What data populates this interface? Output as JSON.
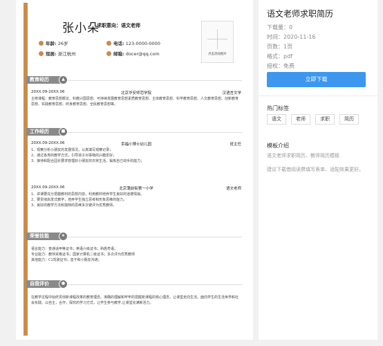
{
  "resume": {
    "name": "张小朵",
    "job_label": "求职意向：",
    "job_value": "语文老师",
    "info": {
      "age_label": "年龄:",
      "age_value": "26岁",
      "phone_label": "电话:",
      "phone_value": "123-0000-0000",
      "location_label": "现居:",
      "location_value": "浙江杭州",
      "email_label": "邮箱:",
      "email_value": "docer@qq.com"
    },
    "photo_caption": "点击添加图片",
    "accent_color": "#c98d4b",
    "sections": {
      "education": {
        "title": "教育经历",
        "icon": "graduation-cap-icon",
        "rows": [
          {
            "date": "20XX.09-20XX.06",
            "org": "北京华安师范学院",
            "role": "汉语言文学"
          }
        ],
        "desc": "主修课程：教育思想概论、科教兴国思想、可持续发展教育思想素质教育思想、主体教育思想、科学教育思想、人文教育思想、创新教育思想、实践教育思想、终身教育思想、全民教育思想等。"
      },
      "work": {
        "title": "工作经历",
        "icon": "briefcase-icon",
        "rows": [
          {
            "date": "20XX.09-20XX.06",
            "org": "幸福小博士幼儿园",
            "role": "班主任",
            "items": [
              "1、观察分析小朋友的发展情况，认真填写观察记录；",
              "2、通过各类的教学方式，引导孩子对事物的兴趣爱好；",
              "3、接待和配合园长要求管理好小朋友的日常生活，锻炼自己动手的能力；"
            ]
          },
          {
            "date": "20XX.09-20XX.06",
            "org": "北京蒲前街第一小学",
            "role": "语文老师",
            "items": [
              "1、讲课要充分把握教材的思想内容，利用教材培养学生良好的道德情操。",
              "2、要贯彻启发式教学，培养学生独立思考和形象思维的能力。",
              "3、良好的教学方法和独特的思维多次被评为优秀教师。"
            ]
          }
        ]
      },
      "skills": {
        "title": "荣誉技能",
        "icon": "trophy-icon",
        "lines": [
          "语言能力：普通话甲等证书；英语六级证书；熟悉粤语；",
          "专业能力：教师资格证书；国家计算机二级证书；多次评为优秀教师",
          "其他能力：C1驾驶证书；善于和小朋友沟通；"
        ]
      },
      "self": {
        "title": "自我评价",
        "icon": "link-icon",
        "desc": "在教学过程中始终贯彻新课程改革的教育理念。准确的理解和牢牢的把握新课程的核心理念，让课堂走向生活，面向学生的生活世界和社会实践。以自主，合作，探究的学习方式，让学生参与教学,让课堂充满新活力。"
      }
    }
  },
  "sidebar": {
    "title": "语文老师求职简历",
    "downloads": "下载量：0",
    "time": "时间：2020-11-16",
    "pages": "页数：1页",
    "format": "格式：pdf",
    "license": "授权：免费",
    "download_button": "立即下载",
    "accent_color": "#3d97ef",
    "tags_heading": "热门标签",
    "tags": [
      "语文",
      "老师",
      "求职",
      "简历"
    ],
    "intro_heading": "模板介绍",
    "intro_text": "语文老师求职简历、教师简历模板",
    "suggestion_text": "建议下载借阅读撰填写表单、适配效果更好。"
  }
}
